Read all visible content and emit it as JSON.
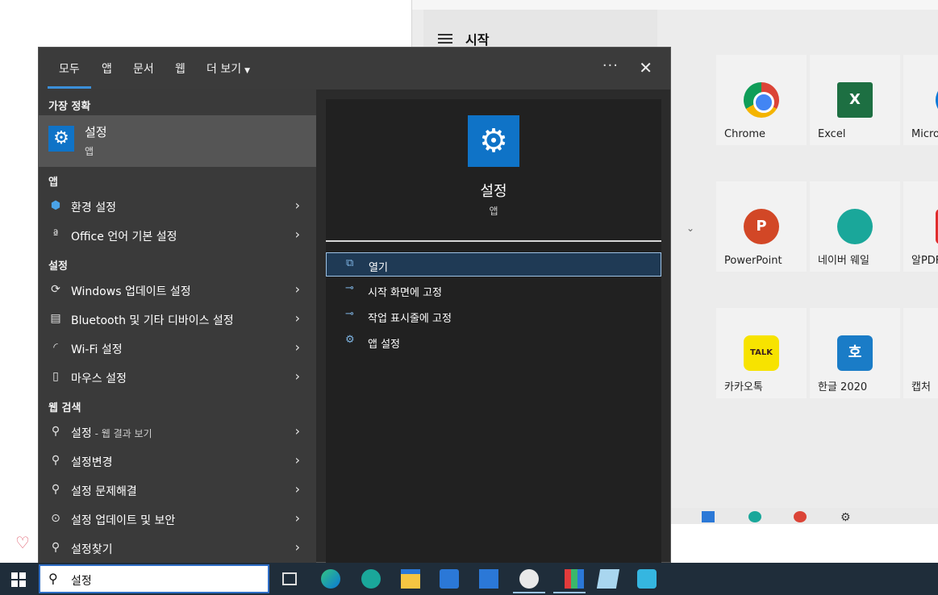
{
  "background": {
    "start_title": "시작",
    "tiles": [
      {
        "label": "Chrome"
      },
      {
        "label": "Excel"
      },
      {
        "label": "Micro"
      },
      {
        "label": "PowerPoint"
      },
      {
        "label": "네이버 웨일"
      },
      {
        "label": "알PDF"
      },
      {
        "label": "카카오톡"
      },
      {
        "label": "한글 2020"
      },
      {
        "label": "캡처"
      }
    ],
    "excel_letter": "X",
    "ppt_letter": "P",
    "kakao_text": "TALK",
    "hangul_letter": "호"
  },
  "panel": {
    "tabs": [
      "모두",
      "앱",
      "문서",
      "웹",
      "더 보기"
    ],
    "more_dots": "···",
    "close_glyph": "✕",
    "sections": {
      "best": "가장 정확",
      "apps": "앱",
      "settings": "설정",
      "web": "웹 검색"
    },
    "best_match": {
      "name": "설정",
      "type": "앱"
    },
    "apps": [
      {
        "label": "환경 설정"
      },
      {
        "label": "Office 언어 기본 설정"
      }
    ],
    "settings": [
      {
        "label": "Windows 업데이트 설정"
      },
      {
        "label": "Bluetooth 및 기타 디바이스 설정"
      },
      {
        "label": "Wi-Fi 설정"
      },
      {
        "label": "마우스 설정"
      }
    ],
    "web": [
      {
        "label": "설정",
        "sub": " - 웹 결과 보기"
      },
      {
        "label": "설정변경",
        "sub": ""
      },
      {
        "label": "설정 문제해결",
        "sub": ""
      },
      {
        "label": "설정 업데이트 및 보안",
        "sub": ""
      },
      {
        "label": "설정찾기",
        "sub": ""
      }
    ],
    "detail": {
      "name": "설정",
      "type": "앱",
      "actions": [
        {
          "label": "열기"
        },
        {
          "label": "시작 화면에 고정"
        },
        {
          "label": "작업 표시줄에 고정"
        },
        {
          "label": "앱 설정"
        }
      ]
    }
  },
  "taskbar": {
    "search_value": "설정"
  },
  "colors": {
    "accent": "#0f73c7",
    "taskbar": "#1f2d3a",
    "selected_action": "#1f3a55"
  }
}
